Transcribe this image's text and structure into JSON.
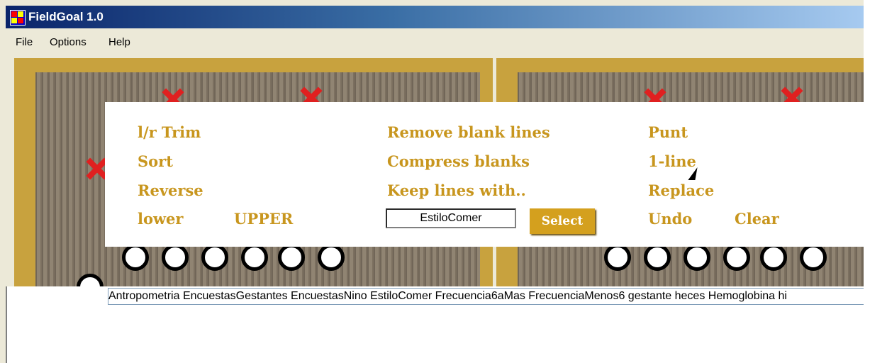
{
  "window": {
    "title": "FieldGoal 1.0"
  },
  "menu": {
    "items": [
      "File",
      "Options",
      "Help"
    ]
  },
  "commands": {
    "lr_trim": "l/r Trim",
    "sort": "Sort",
    "reverse": "Reverse",
    "lower": "lower",
    "upper": "UPPER",
    "remove_blank": "Remove blank lines",
    "compress_blanks": "Compress blanks",
    "keep_lines": "Keep  lines with..",
    "punt": "Punt",
    "one_line": "1-line",
    "replace": "Replace",
    "undo": "Undo",
    "clear": "Clear"
  },
  "filter": {
    "value": "EstiloComer",
    "select_label": "Select"
  },
  "list": {
    "text": "Antropometria EncuestasGestantes EncuestasNino EstiloComer Frecuencia6aMas FrecuenciaMenos6 gestante heces Hemoglobina hi"
  },
  "colors": {
    "command_text": "#c8961e",
    "select_button": "#d4a01e",
    "field_gold": "#c8a23e",
    "title_blue": "#0a246a"
  }
}
